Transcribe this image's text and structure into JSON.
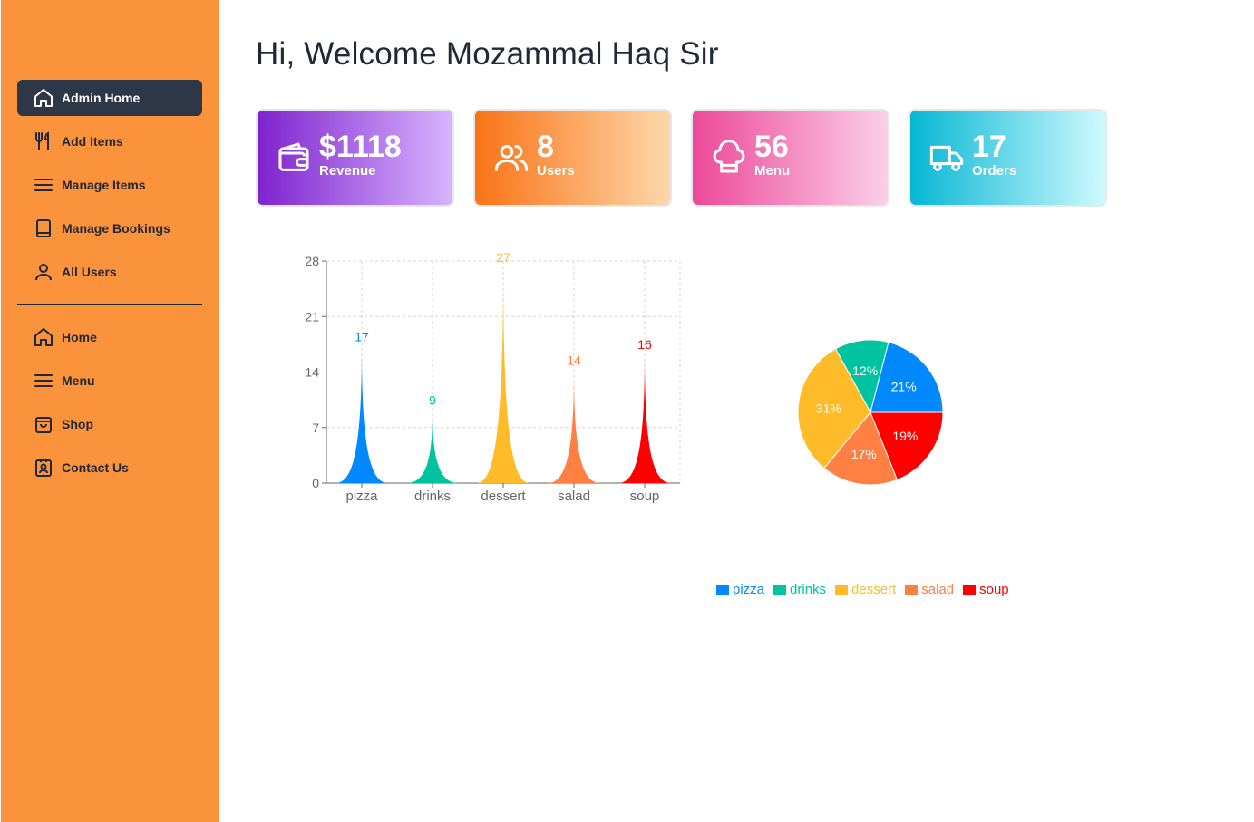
{
  "sidebar": {
    "items": [
      {
        "label": "Admin Home",
        "icon": "home-icon",
        "active": true
      },
      {
        "label": "Add Items",
        "icon": "utensils-icon"
      },
      {
        "label": "Manage Items",
        "icon": "menu-lines-icon"
      },
      {
        "label": "Manage Bookings",
        "icon": "book-icon"
      },
      {
        "label": "All Users",
        "icon": "user-icon"
      }
    ],
    "items2": [
      {
        "label": "Home",
        "icon": "home-icon"
      },
      {
        "label": "Menu",
        "icon": "menu-lines-icon"
      },
      {
        "label": "Shop",
        "icon": "shopping-bag-icon"
      },
      {
        "label": "Contact Us",
        "icon": "contact-card-icon"
      }
    ],
    "bg_color": "#fb923c",
    "active_color": "#2d3748"
  },
  "header": {
    "title": "Hi, Welcome Mozammal Haq Sir"
  },
  "stats": [
    {
      "value": "$1118",
      "label": "Revenue",
      "icon": "wallet-icon",
      "from": "#7e22ce",
      "to": "#d8b4fe"
    },
    {
      "value": "8",
      "label": "Users",
      "icon": "users-icon",
      "from": "#f97316",
      "to": "#fed7aa"
    },
    {
      "value": "56",
      "label": "Menu",
      "icon": "chef-hat-icon",
      "from": "#ec4899",
      "to": "#fbcfe8"
    },
    {
      "value": "17",
      "label": "Orders",
      "icon": "truck-icon",
      "from": "#06b6d4",
      "to": "#cffafe"
    }
  ],
  "chart_data": [
    {
      "type": "bar",
      "categories": [
        "pizza",
        "drinks",
        "dessert",
        "salad",
        "soup"
      ],
      "values": [
        17,
        9,
        27,
        14,
        16
      ],
      "colors": [
        "#0088FE",
        "#00C49F",
        "#FFBB28",
        "#FF8042",
        "#FF0000"
      ],
      "yticks": [
        0,
        7,
        14,
        21,
        28
      ],
      "ylim": [
        0,
        28
      ],
      "grid": true,
      "data_labels": true
    },
    {
      "type": "pie",
      "labels": [
        "pizza",
        "drinks",
        "dessert",
        "salad",
        "soup"
      ],
      "values": [
        21,
        12,
        31,
        17,
        19
      ],
      "value_labels": [
        "21%",
        "12%",
        "31%",
        "17%",
        "19%"
      ],
      "colors": [
        "#0088FE",
        "#00C49F",
        "#FFBB28",
        "#FF8042",
        "#FF0000"
      ],
      "legend": "bottom"
    }
  ]
}
